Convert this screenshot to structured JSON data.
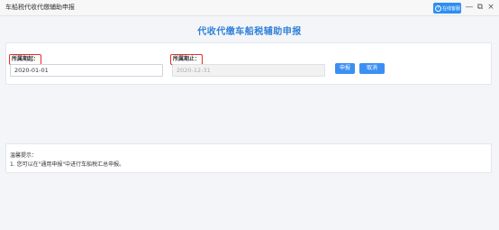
{
  "window": {
    "title": "车船税代收代缴辅助申报",
    "help_label": "在线客服",
    "minimize_symbol": "—",
    "restore_symbol": "⧉",
    "close_symbol": "×"
  },
  "page": {
    "title": "代收代缴车船税辅助申报"
  },
  "form": {
    "start_label": "所属期起：",
    "start_value": "2020-01-01",
    "end_label": "所属期止：",
    "end_value": "2020-12-31",
    "declare_button": "申报",
    "cancel_button": "取消"
  },
  "tips": {
    "title": "温馨提示：",
    "items": [
      "1. 您可以在\"通用申报\"中进行车船税汇总申报。"
    ]
  },
  "colors": {
    "accent": "#2f80d8",
    "button": "#3b8ff3",
    "highlight_border": "#e0302a"
  }
}
